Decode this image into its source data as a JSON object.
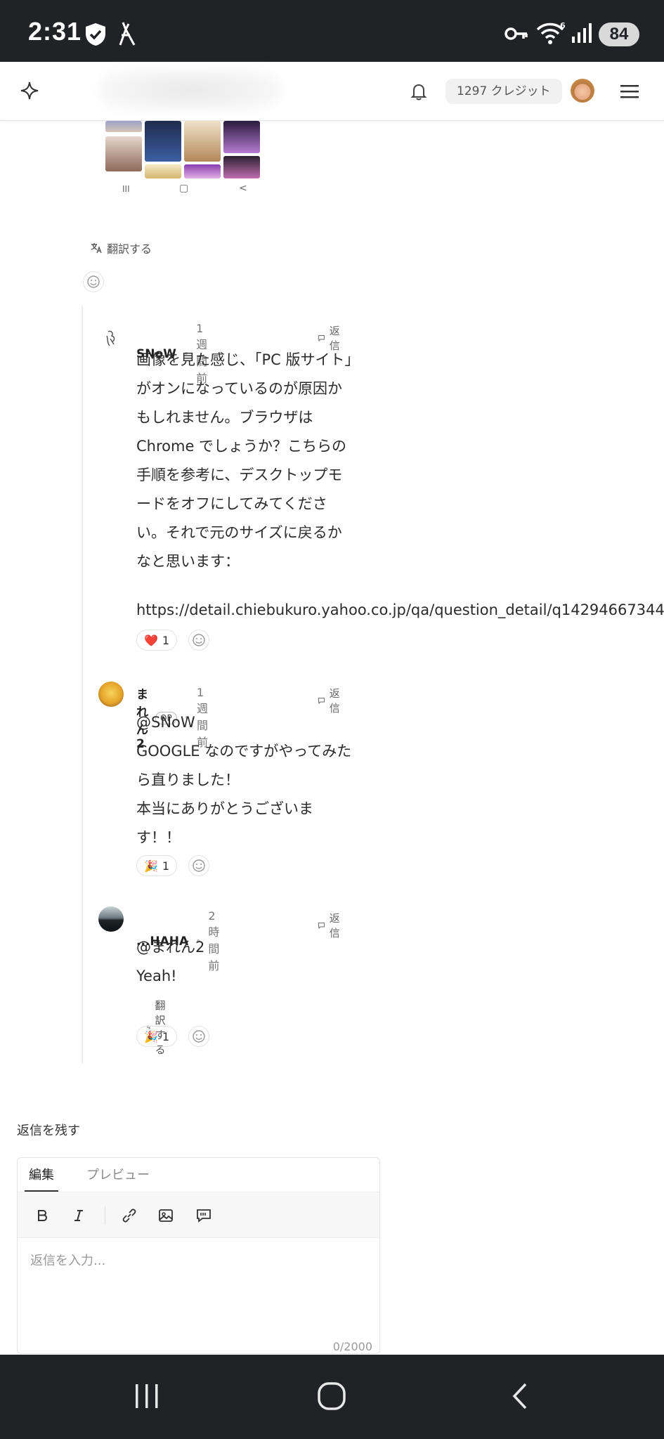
{
  "status_bar": {
    "time": "2:31",
    "battery": "84"
  },
  "header": {
    "credits": "1297 クレジット"
  },
  "thumbnail_nav": {
    "recent": "III",
    "home": "▢",
    "back": "<"
  },
  "post": {
    "translate_label": "翻訳する"
  },
  "comments": [
    {
      "author": "SNoW",
      "time": "1 週間前",
      "reply_label": "返信",
      "lines": [
        "画像を見た感じ、「PC 版サイト」",
        "がオンになっているのが原因か",
        "もしれません。ブラウザは",
        "Chrome でしょうか？こちらの",
        "手順を参考に、デスクトップモ",
        "ードをオフにしてみてくださ",
        "い。それで元のサイズに戻るか",
        "なと思います："
      ],
      "link": "https://detail.chiebukuro.yahoo.co.jp/qa/question_detail/q14294667344",
      "reaction": {
        "emoji": "❤️",
        "count": "1"
      }
    },
    {
      "author": "まれん2",
      "op_badge": "OP",
      "time": "1 週間前",
      "reply_label": "返信",
      "lines": [
        "@SNoW",
        "GOOGLE なのですがやってみた",
        "ら直りました！",
        "本当にありがとうございま",
        "す！！"
      ],
      "reaction": {
        "emoji": "🎉",
        "count": "1"
      }
    },
    {
      "author": "...HAHA",
      "time": "2 時間前",
      "reply_label": "返信",
      "lines": [
        "@まれん2",
        "Yeah!"
      ],
      "translate_label": "翻訳する",
      "reaction": {
        "emoji": "🎉",
        "count": "1"
      }
    }
  ],
  "reply_form": {
    "title": "返信を残す",
    "tab_edit": "編集",
    "tab_preview": "プレビュー",
    "placeholder": "返信を入力...",
    "counter": "0/2000"
  }
}
